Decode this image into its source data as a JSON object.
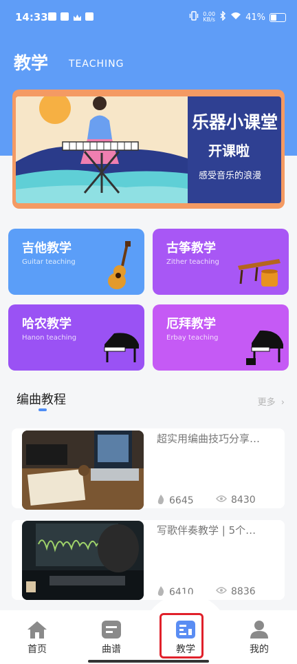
{
  "status_bar": {
    "time": "14:33",
    "net_speed": "0.00\nKB/s",
    "battery": "41%"
  },
  "header": {
    "title": "教学",
    "subtitle": "TEACHING"
  },
  "banner": {
    "line1": "乐器小课堂",
    "line2": "开课啦",
    "line3": "感受音乐的浪漫"
  },
  "categories": [
    {
      "title": "吉他教学",
      "subtitle": "Guitar teaching",
      "color": "#5b9ef8"
    },
    {
      "title": "古筝教学",
      "subtitle": "Zither teaching",
      "color": "#a857f5"
    },
    {
      "title": "哈农教学",
      "subtitle": "Hanon teaching",
      "color": "#9a52f4"
    },
    {
      "title": "厄拜教学",
      "subtitle": "Erbay teaching",
      "color": "#c55af5"
    }
  ],
  "section": {
    "title": "编曲教程",
    "more": "更多"
  },
  "tutorials": [
    {
      "title": "超实用编曲技巧分享…",
      "likes": "6645",
      "views": "8430"
    },
    {
      "title": "写歌伴奏教学 | 5个…",
      "likes": "6410",
      "views": "8836"
    }
  ],
  "tabs": [
    {
      "label": "首页",
      "icon": "home-icon"
    },
    {
      "label": "曲谱",
      "icon": "score-icon"
    },
    {
      "label": "教学",
      "icon": "teaching-icon"
    },
    {
      "label": "我的",
      "icon": "profile-icon"
    }
  ]
}
